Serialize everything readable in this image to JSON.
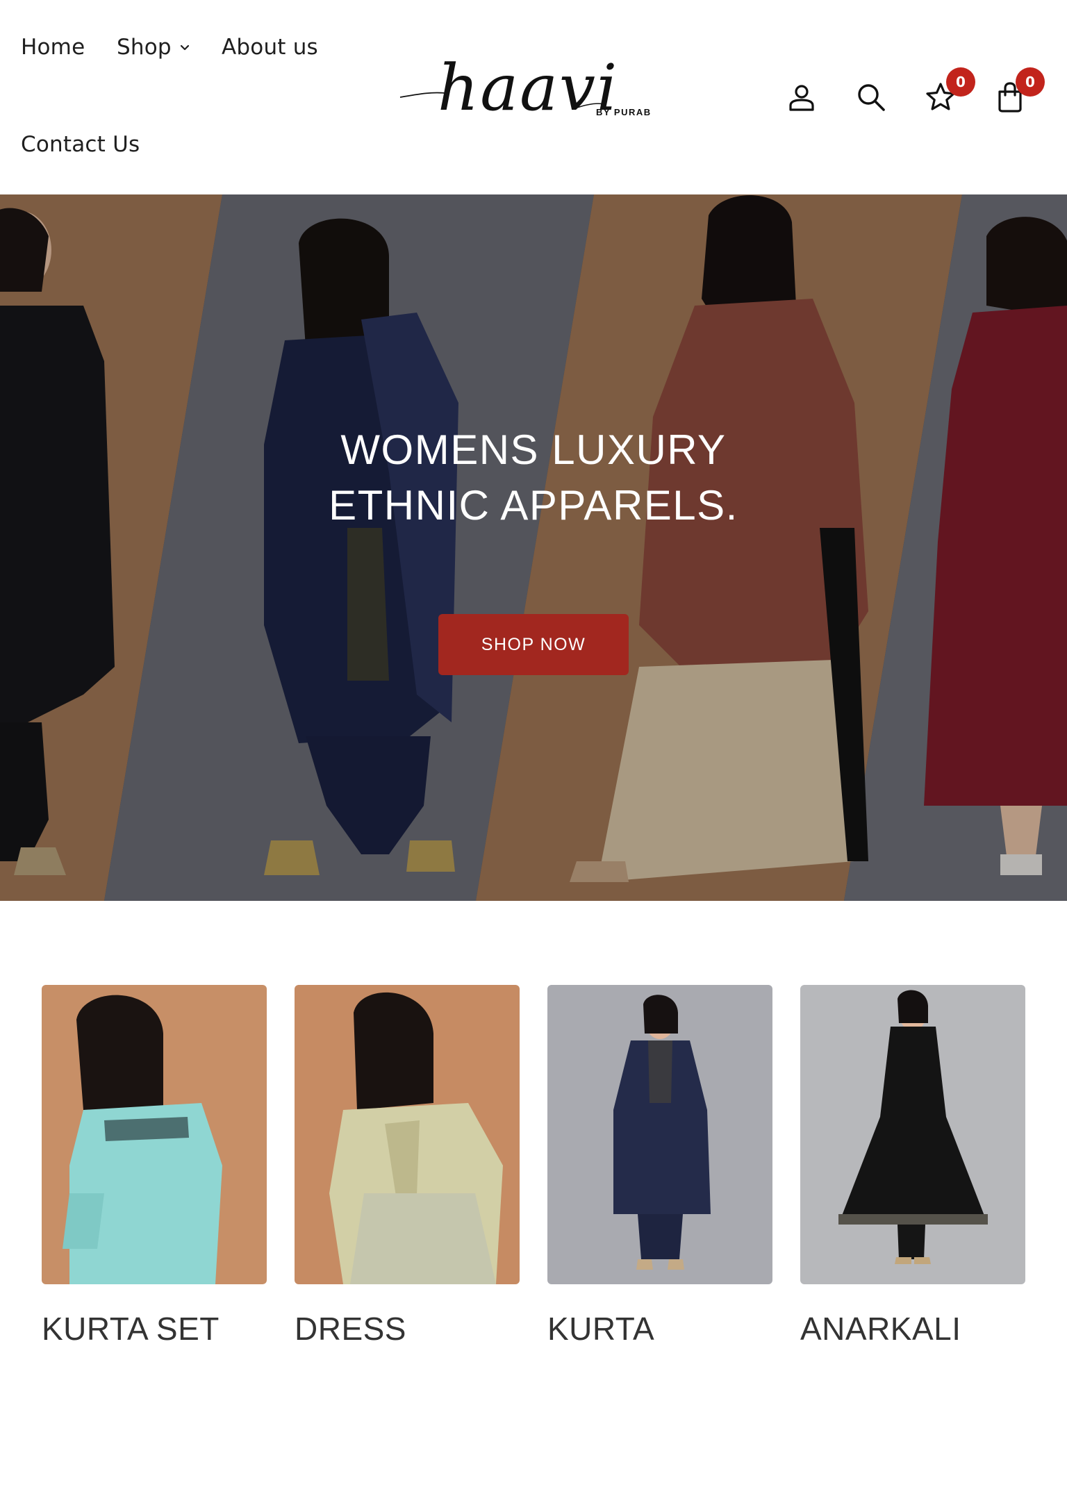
{
  "header": {
    "nav": {
      "home": "Home",
      "shop": "Shop",
      "about": "About us",
      "contact": "Contact Us"
    },
    "logo": {
      "script_text": "haavi",
      "tagline": "BY PURAB"
    },
    "icons": {
      "account": "user-icon",
      "search": "search-icon",
      "wishlist": "star-icon",
      "cart": "shopping-bag-icon"
    },
    "wishlist_count": "0",
    "cart_count": "0"
  },
  "hero": {
    "title_line1": "WOMENS LUXURY",
    "title_line2": "ETHNIC APPARELS.",
    "cta_label": "SHOP NOW"
  },
  "categories": [
    {
      "label": "KURTA SET"
    },
    {
      "label": "DRESS"
    },
    {
      "label": "KURTA"
    },
    {
      "label": "ANARKALI"
    }
  ],
  "colors": {
    "accent": "#a2271f",
    "badge": "#c2241c",
    "text": "#1f1f1f"
  }
}
